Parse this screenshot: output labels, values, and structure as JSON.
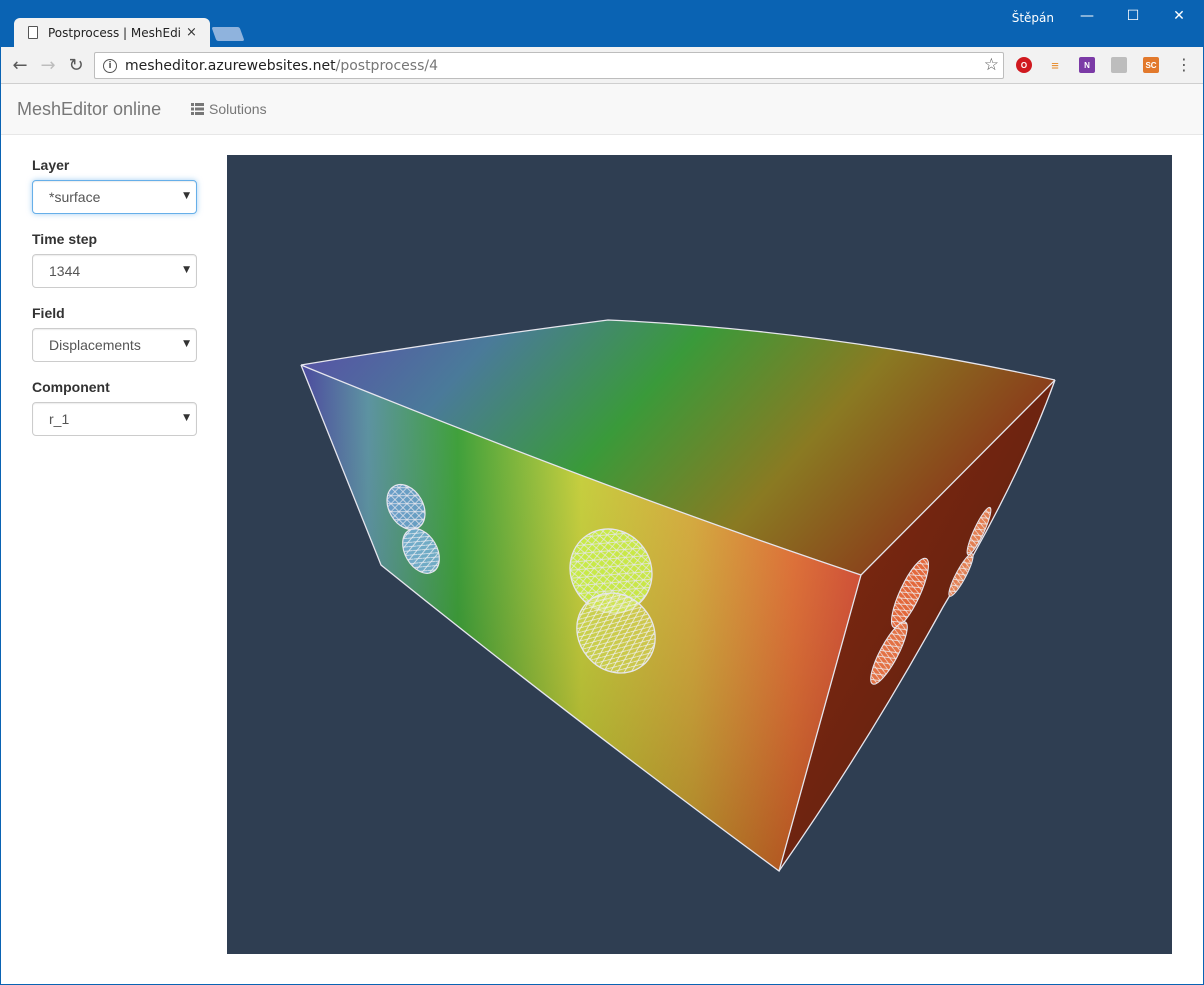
{
  "window": {
    "user_name": "Štěpán",
    "min_glyph": "—",
    "max_glyph": "☐",
    "close_glyph": "✕"
  },
  "tab": {
    "title": "Postprocess | MeshEditor online",
    "close_glyph": "×"
  },
  "address_bar": {
    "host": "mesheditor.azurewebsites.net",
    "path": "/postprocess/4",
    "info_glyph": "i",
    "star_glyph": "☆"
  },
  "extensions": [
    {
      "name": "opera-vpn-icon",
      "glyph": "O"
    },
    {
      "name": "stack-overflow-icon",
      "glyph": "≡"
    },
    {
      "name": "onenote-icon",
      "glyph": "N"
    },
    {
      "name": "image-extension-icon",
      "glyph": ""
    },
    {
      "name": "sc-extension-icon",
      "glyph": "SC"
    }
  ],
  "navbar": {
    "brand": "MeshEditor online",
    "solutions_label": "Solutions"
  },
  "form": {
    "layer": {
      "label": "Layer",
      "value": "*surface"
    },
    "time_step": {
      "label": "Time step",
      "value": "1344"
    },
    "field": {
      "label": "Field",
      "value": "Displacements"
    },
    "component": {
      "label": "Component",
      "value": "r_1"
    }
  },
  "colors": {
    "titlebar": "#0a63b3",
    "viewport_bg": "#2f3e52",
    "mesh_edge": "#e6e6ee"
  }
}
